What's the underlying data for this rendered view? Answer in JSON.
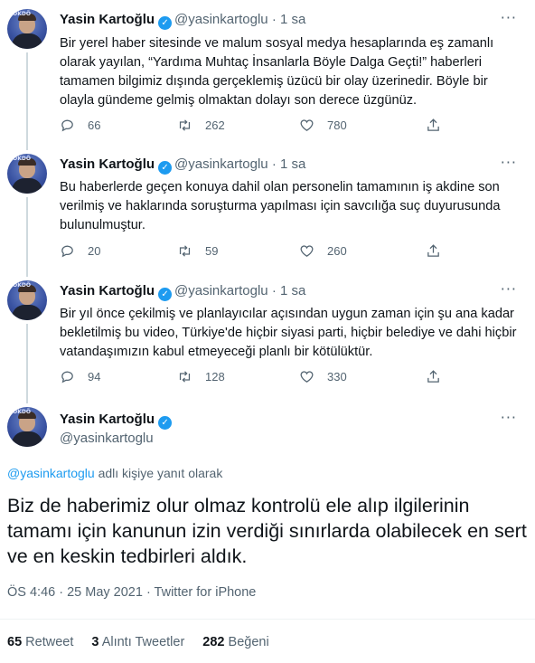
{
  "colors": {
    "accent": "#1d9bf0",
    "muted": "#536471",
    "text": "#0f1419"
  },
  "author": {
    "name": "Yasin Kartoğlu",
    "handle": "@yasinkartoglu",
    "verified_icon": "verified-badge-icon"
  },
  "tweets": [
    {
      "meta": "· 1 sa",
      "text": "Bir yerel haber sitesinde ve malum sosyal medya hesaplarında eş zamanlı olarak yayılan, “Yardıma Muhtaç İnsanlarla Böyle Dalga Geçti!” haberleri tamamen bilgimiz dışında gerçeklemiş üzücü bir olay üzerinedir. Böyle bir olayla gündeme gelmiş olmaktan dolayı son derece üzgünüz.",
      "replies": "66",
      "retweets": "262",
      "likes": "780"
    },
    {
      "meta": "· 1 sa",
      "text": "Bu haberlerde geçen konuya dahil olan personelin tamamının iş akdine son verilmiş ve haklarında soruşturma yapılması için savcılığa suç duyurusunda bulunulmuştur.",
      "replies": "20",
      "retweets": "59",
      "likes": "260"
    },
    {
      "meta": "· 1 sa",
      "text": "Bir yıl önce çekilmiş ve planlayıcılar açısından uygun zaman için şu ana kadar bekletilmiş bu video, Türkiye'de hiçbir siyasi parti, hiçbir belediye ve dahi hiçbir vatandaşımızın kabul etmeyeceği planlı bir kötülüktür.",
      "replies": "94",
      "retweets": "128",
      "likes": "330"
    }
  ],
  "main_tweet": {
    "replying_mention": "@yasinkartoglu",
    "replying_suffix": " adlı kişiye yanıt olarak",
    "text": "Biz de haberimiz olur olmaz kontrolü ele alıp ilgilerinin tamamı için kanunun izin verdiği sınırlarda olabilecek en sert ve en keskin tedbirleri aldık.",
    "timestamp": "ÖS 4:46 · 25 May 2021 · Twitter for iPhone",
    "retweets_count": "65",
    "retweets_label": "Retweet",
    "quotes_count": "3",
    "quotes_label": "Alıntı Tweetler",
    "likes_count": "282",
    "likes_label": "Beğeni"
  }
}
